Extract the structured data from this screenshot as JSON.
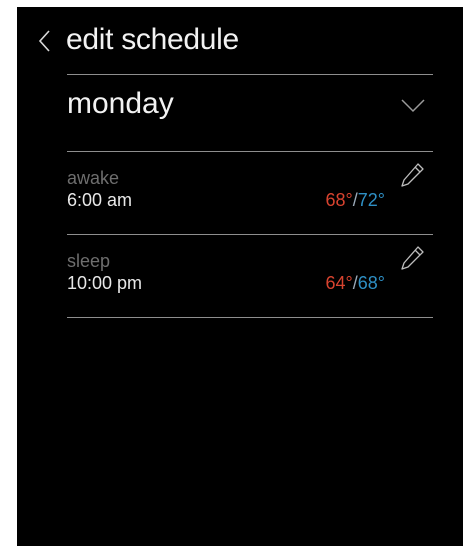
{
  "header": {
    "title": "edit schedule"
  },
  "day_selector": {
    "selected": "monday"
  },
  "periods": [
    {
      "name": "awake",
      "time": "6:00 am",
      "heat_setpoint": "68°",
      "separator": "/",
      "cool_setpoint": "72°"
    },
    {
      "name": "sleep",
      "time": "10:00 pm",
      "heat_setpoint": "64°",
      "separator": "/",
      "cool_setpoint": "68°"
    }
  ],
  "colors": {
    "background": "#000000",
    "heat": "#d8432f",
    "cool": "#2e8fc4",
    "muted_text": "#6e6e6e"
  },
  "icons": {
    "back": "chevron-left-icon",
    "dropdown": "chevron-down-icon",
    "edit": "pencil-icon"
  }
}
